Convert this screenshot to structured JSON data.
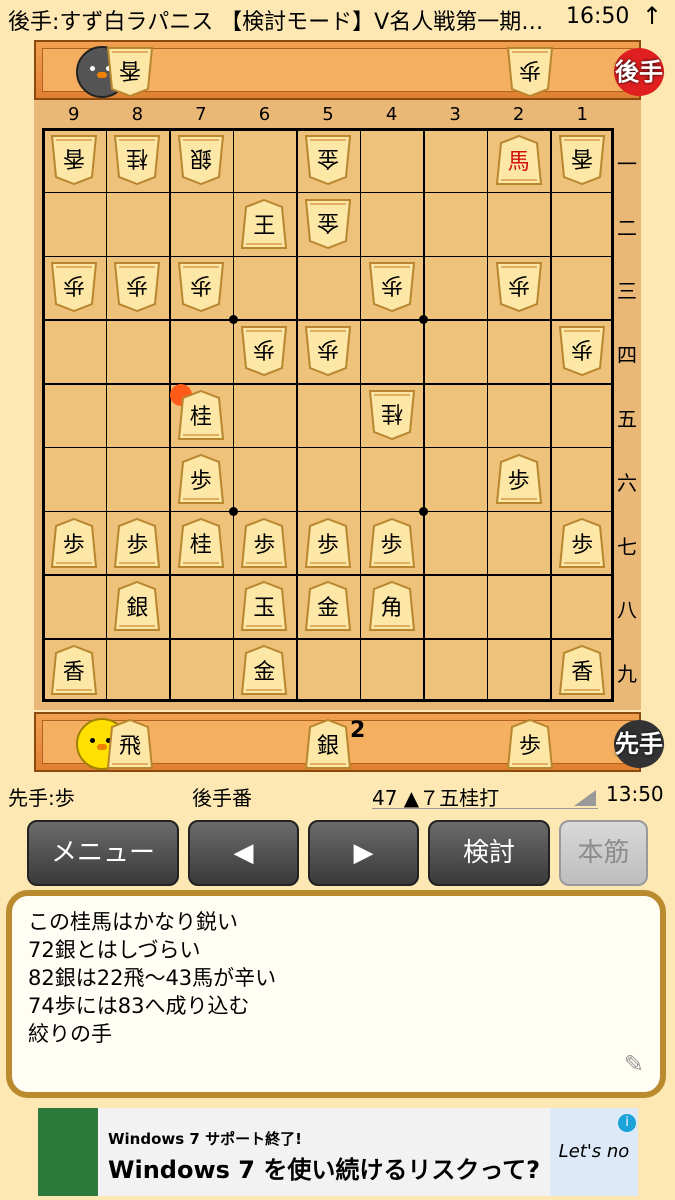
{
  "status": {
    "title": "後手:すず白ラパニス 【検討モード】V名人戦第一期…",
    "time": "16:50",
    "arrow": "↑"
  },
  "gote": {
    "badge": "後手",
    "hand": [
      {
        "piece": "香"
      },
      {
        "piece": "歩"
      }
    ]
  },
  "sente": {
    "badge": "先手",
    "hand": [
      {
        "piece": "飛"
      },
      {
        "piece": "銀",
        "count": "2"
      },
      {
        "piece": "歩"
      }
    ]
  },
  "columns": [
    "9",
    "8",
    "7",
    "6",
    "5",
    "4",
    "3",
    "2",
    "1"
  ],
  "rows": [
    "一",
    "二",
    "三",
    "四",
    "五",
    "六",
    "七",
    "八",
    "九"
  ],
  "board": [
    {
      "col": 9,
      "row": 1,
      "p": "香",
      "gote": true
    },
    {
      "col": 8,
      "row": 1,
      "p": "桂",
      "gote": true
    },
    {
      "col": 7,
      "row": 1,
      "p": "銀",
      "gote": true
    },
    {
      "col": 5,
      "row": 1,
      "p": "金",
      "gote": true
    },
    {
      "col": 2,
      "row": 1,
      "p": "馬",
      "gote": false,
      "red": true
    },
    {
      "col": 1,
      "row": 1,
      "p": "香",
      "gote": true
    },
    {
      "col": 6,
      "row": 2,
      "p": "王",
      "gote": false
    },
    {
      "col": 5,
      "row": 2,
      "p": "金",
      "gote": true
    },
    {
      "col": 9,
      "row": 3,
      "p": "歩",
      "gote": true
    },
    {
      "col": 8,
      "row": 3,
      "p": "歩",
      "gote": true
    },
    {
      "col": 7,
      "row": 3,
      "p": "歩",
      "gote": true
    },
    {
      "col": 4,
      "row": 3,
      "p": "歩",
      "gote": true
    },
    {
      "col": 2,
      "row": 3,
      "p": "歩",
      "gote": true
    },
    {
      "col": 6,
      "row": 4,
      "p": "歩",
      "gote": true
    },
    {
      "col": 5,
      "row": 4,
      "p": "歩",
      "gote": true
    },
    {
      "col": 1,
      "row": 4,
      "p": "歩",
      "gote": true
    },
    {
      "col": 7,
      "row": 5,
      "p": "桂",
      "gote": false
    },
    {
      "col": 4,
      "row": 5,
      "p": "桂",
      "gote": true
    },
    {
      "col": 7,
      "row": 6,
      "p": "歩",
      "gote": false
    },
    {
      "col": 2,
      "row": 6,
      "p": "歩",
      "gote": false
    },
    {
      "col": 9,
      "row": 7,
      "p": "歩",
      "gote": false
    },
    {
      "col": 8,
      "row": 7,
      "p": "歩",
      "gote": false
    },
    {
      "col": 7,
      "row": 7,
      "p": "桂",
      "gote": false
    },
    {
      "col": 6,
      "row": 7,
      "p": "歩",
      "gote": false
    },
    {
      "col": 5,
      "row": 7,
      "p": "歩",
      "gote": false
    },
    {
      "col": 4,
      "row": 7,
      "p": "歩",
      "gote": false
    },
    {
      "col": 1,
      "row": 7,
      "p": "歩",
      "gote": false
    },
    {
      "col": 8,
      "row": 8,
      "p": "銀",
      "gote": false
    },
    {
      "col": 6,
      "row": 8,
      "p": "玉",
      "gote": false
    },
    {
      "col": 5,
      "row": 8,
      "p": "金",
      "gote": false
    },
    {
      "col": 4,
      "row": 8,
      "p": "角",
      "gote": false
    },
    {
      "col": 9,
      "row": 9,
      "p": "香",
      "gote": false
    },
    {
      "col": 6,
      "row": 9,
      "p": "金",
      "gote": false
    },
    {
      "col": 1,
      "row": 9,
      "p": "香",
      "gote": false
    }
  ],
  "info": {
    "sente": "先手:歩",
    "turn": "後手番",
    "move": "47 ▲７五桂打",
    "clock": "13:50"
  },
  "buttons": {
    "menu": "メニュー",
    "prev": "◀",
    "next": "▶",
    "analyze": "検討",
    "main": "本筋"
  },
  "memo": {
    "lines": [
      "この桂馬はかなり鋭い",
      "72銀とはしづらい",
      "82銀は22飛～43馬が辛い",
      "74歩には83へ成り込む",
      "絞りの手"
    ],
    "pen": "✎"
  },
  "ad": {
    "small": "Windows 7 サポート終了!",
    "big": "Windows 7 を使い続けるリスクって?",
    "right": "Let's no",
    "i": "i"
  }
}
